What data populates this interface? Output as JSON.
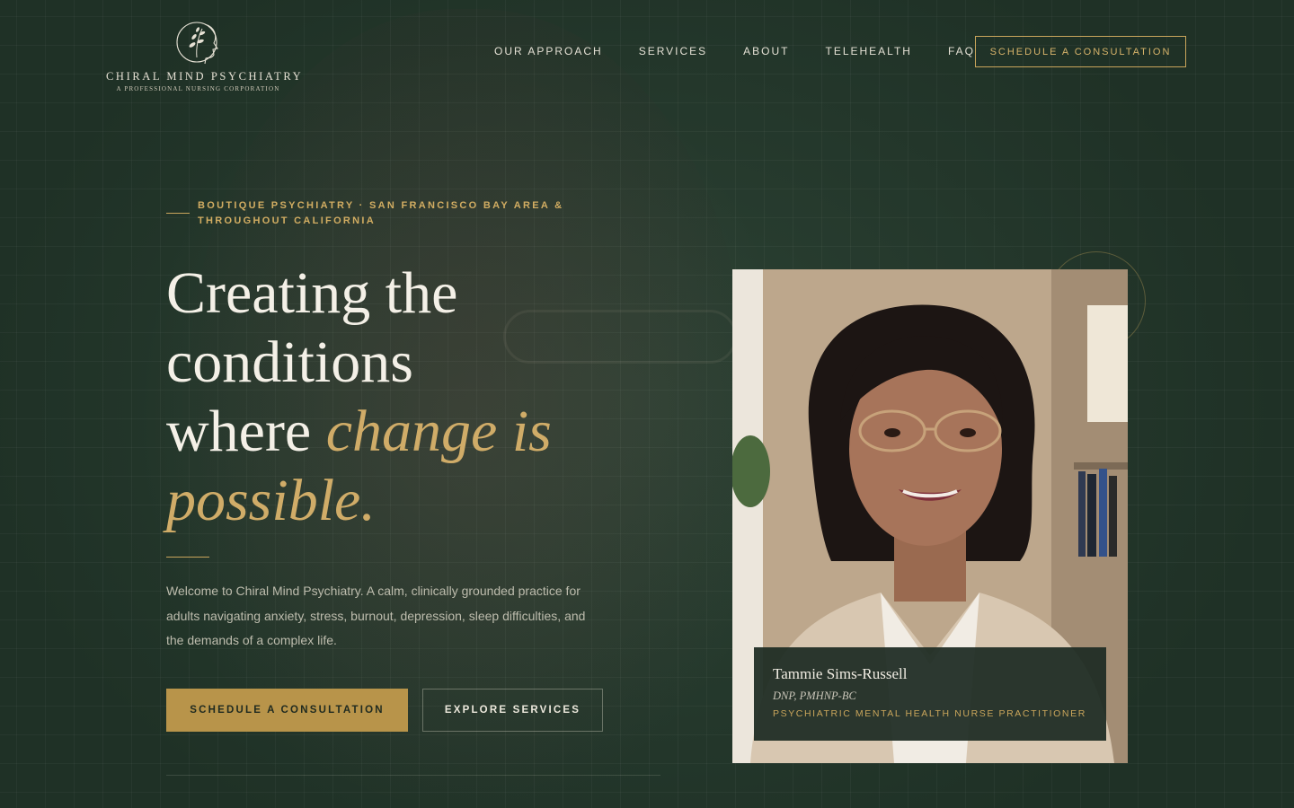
{
  "brand": {
    "name": "CHIRAL MIND PSYCHIATRY",
    "tagline": "A PROFESSIONAL NURSING CORPORATION"
  },
  "nav": {
    "items": [
      {
        "label": "OUR APPROACH"
      },
      {
        "label": "SERVICES"
      },
      {
        "label": "ABOUT"
      },
      {
        "label": "TELEHEALTH"
      },
      {
        "label": "FAQ"
      }
    ],
    "cta_label": "SCHEDULE A CONSULTATION"
  },
  "hero": {
    "eyebrow": "BOUTIQUE PSYCHIATRY · SAN FRANCISCO BAY AREA & THROUGHOUT CALIFORNIA",
    "headline_line1": "Creating the",
    "headline_line2": "conditions",
    "headline_line3": "where ",
    "headline_accent1": "change is",
    "headline_accent2": "possible.",
    "lede": "Welcome to Chiral Mind Psychiatry. A calm, clinically grounded practice for adults navigating anxiety, stress, burnout, depression, sleep difficulties, and the demands of a complex life.",
    "primary_button": "SCHEDULE A CONSULTATION",
    "secondary_button": "EXPLORE SERVICES"
  },
  "provider": {
    "name": "Tammie Sims-Russell",
    "credentials": "DNP, PMHNP-BC",
    "role": "PSYCHIATRIC MENTAL HEALTH NURSE PRACTITIONER"
  },
  "colors": {
    "background": "#24372b",
    "accent_gold": "#c9a55b",
    "text_light": "#f4f0e7"
  }
}
